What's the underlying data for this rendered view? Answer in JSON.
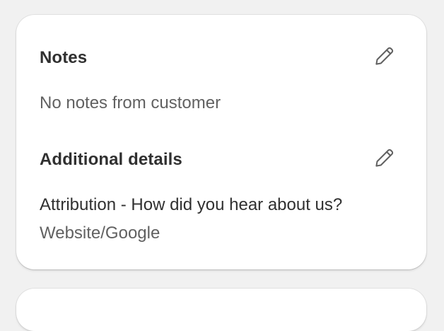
{
  "notes": {
    "title": "Notes",
    "body": "No notes from customer",
    "edit_icon": "pencil-icon"
  },
  "additional_details": {
    "title": "Additional details",
    "edit_icon": "pencil-icon",
    "items": [
      {
        "label": "Attribution - How did you hear about us?",
        "value": "Website/Google"
      }
    ]
  },
  "colors": {
    "background": "#f1f1f1",
    "card": "#ffffff",
    "text_primary": "#303030",
    "text_muted": "#616161",
    "icon": "#616161"
  }
}
